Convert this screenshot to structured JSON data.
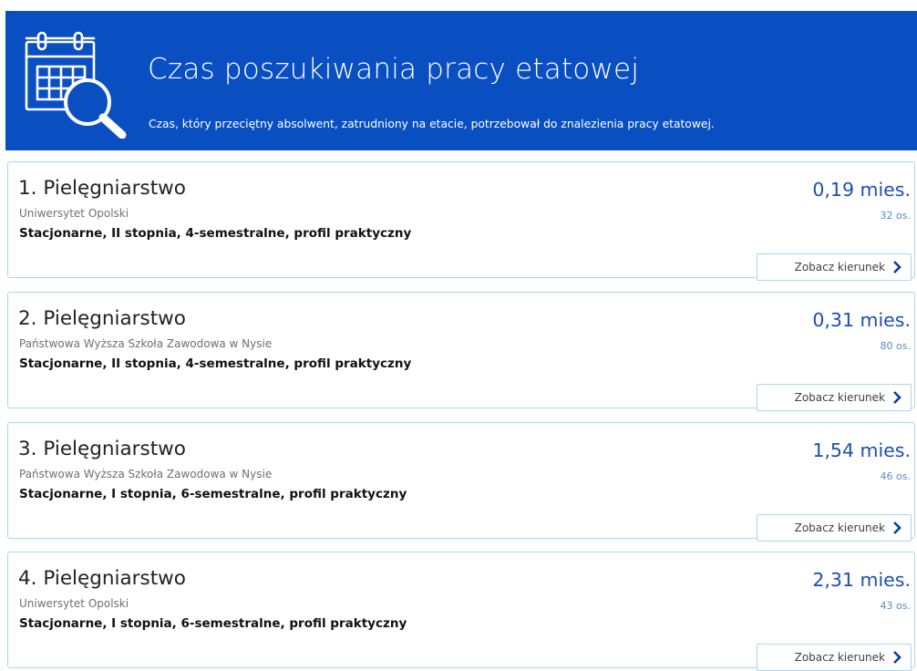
{
  "header": {
    "title": "Czas poszukiwania pracy etatowej",
    "subtitle": "Czas, który przeciętny absolwent, zatrudniony na etacie, potrzebował do znalezienia pracy etatowej.",
    "icon": "calendar-search-icon",
    "background_color": "#0a4fc2"
  },
  "cards": [
    {
      "name": "1. Pielęgniarstwo",
      "university": "Uniwersytet Opolski",
      "mode": "Stacjonarne, II stopnia, 4-semestralne, profil praktyczny",
      "value": "0,19 mies.",
      "count": "32 os.",
      "button": "Zobacz kierunek"
    },
    {
      "name": "2. Pielęgniarstwo",
      "university": "Państwowa Wyższa Szkoła Zawodowa w Nysie",
      "mode": "Stacjonarne, II stopnia, 4-semestralne, profil praktyczny",
      "value": "0,31 mies.",
      "count": "80 os.",
      "button": "Zobacz kierunek"
    },
    {
      "name": "3. Pielęgniarstwo",
      "university": "Państwowa Wyższa Szkoła Zawodowa w Nysie",
      "mode": "Stacjonarne, I stopnia, 6-semestralne, profil praktyczny",
      "value": "1,54 mies.",
      "count": "46 os.",
      "button": "Zobacz kierunek"
    },
    {
      "name": "4. Pielęgniarstwo",
      "university": "Uniwersytet Opolski",
      "mode": "Stacjonarne, I stopnia, 6-semestralne, profil praktyczny",
      "value": "2,31 mies.",
      "count": "43 os.",
      "button": "Zobacz kierunek"
    }
  ],
  "colors": {
    "value": "#1d4fb0",
    "card_border": "#a8d8ee"
  }
}
